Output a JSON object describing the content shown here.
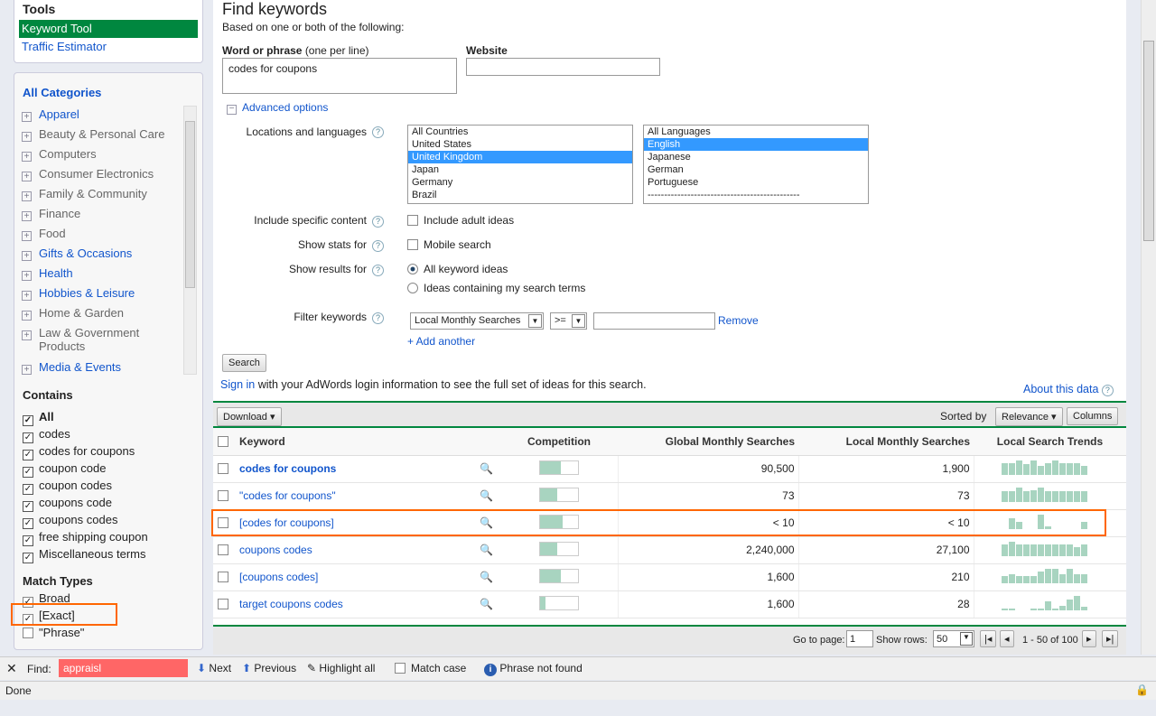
{
  "sidebar": {
    "tools_title": "Tools",
    "tools": [
      "Keyword Tool",
      "Traffic Estimator"
    ],
    "categories_title": "All Categories",
    "categories": [
      "Apparel",
      "Beauty & Personal Care",
      "Computers",
      "Consumer Electronics",
      "Family & Community",
      "Finance",
      "Food",
      "Gifts & Occasions",
      "Health",
      "Hobbies & Leisure",
      "Home & Garden",
      "Law & Government Products",
      "Media & Events"
    ],
    "contains_title": "Contains",
    "contains": [
      "All",
      "codes",
      "codes for coupons",
      "coupon code",
      "coupon codes",
      "coupons code",
      "coupons codes",
      "free shipping coupon",
      "Miscellaneous terms"
    ],
    "match_title": "Match Types",
    "match": [
      {
        "label": "Broad",
        "checked": true
      },
      {
        "label": "[Exact]",
        "checked": true
      },
      {
        "label": "\"Phrase\"",
        "checked": false
      }
    ]
  },
  "form": {
    "title": "Find keywords",
    "subtitle": "Based on one or both of the following:",
    "word_label": "Word or phrase",
    "word_hint": "(one per line)",
    "word_value": "codes for coupons",
    "website_label": "Website",
    "advanced": "Advanced options",
    "loc_label": "Locations and languages",
    "locations": [
      "All Countries",
      "United States",
      "United Kingdom",
      "Japan",
      "Germany",
      "Brazil"
    ],
    "selected_location": "United Kingdom",
    "languages": [
      "All Languages",
      "English",
      "Japanese",
      "German",
      "Portuguese",
      "----------------------------------------------"
    ],
    "selected_language": "English",
    "include_label": "Include specific content",
    "include_opt": "Include adult ideas",
    "stats_label": "Show stats for",
    "stats_opt": "Mobile search",
    "results_label": "Show results for",
    "results_opts": [
      "All keyword ideas",
      "Ideas containing my search terms"
    ],
    "filter_label": "Filter keywords",
    "filter_field": "Local Monthly Searches",
    "filter_op": ">=",
    "remove": "Remove",
    "add_another": "+ Add another",
    "search_btn": "Search",
    "signin": "Sign in",
    "signin_rest": " with your AdWords login information to see the full set of ideas for this search.",
    "about": "About this data"
  },
  "results": {
    "download": "Download",
    "sorted_by": "Sorted by",
    "sort_value": "Relevance",
    "columns": "Columns",
    "headers": [
      "Keyword",
      "Competition",
      "Global Monthly Searches",
      "Local Monthly Searches",
      "Local Search Trends"
    ],
    "rows": [
      {
        "keyword": "codes for coupons",
        "bold": true,
        "competition": 0.55,
        "global": "90,500",
        "local": "1,900",
        "trend": [
          0.8,
          0.8,
          1,
          0.7,
          1,
          0.6,
          0.8,
          1,
          0.8,
          0.8,
          0.8,
          0.6
        ]
      },
      {
        "keyword": "\"codes for coupons\"",
        "competition": 0.45,
        "global": "73",
        "local": "73",
        "trend": [
          0.7,
          0.7,
          1,
          0.7,
          0.8,
          1,
          0.7,
          0.7,
          0.7,
          0.7,
          0.7,
          0.7
        ]
      },
      {
        "keyword": "[codes for coupons]",
        "competition": 0.6,
        "global": "< 10",
        "local": "< 10",
        "trend": [
          0,
          0.7,
          0.5,
          0,
          0,
          1,
          0.15,
          0,
          0,
          0,
          0,
          0.5
        ]
      },
      {
        "keyword": "coupons codes",
        "competition": 0.45,
        "global": "2,240,000",
        "local": "27,100",
        "trend": [
          0.8,
          1,
          0.8,
          0.8,
          0.8,
          0.8,
          0.8,
          0.8,
          0.8,
          0.8,
          0.6,
          0.8
        ]
      },
      {
        "keyword": "[coupons codes]",
        "competition": 0.55,
        "global": "1,600",
        "local": "210",
        "trend": [
          0.5,
          0.6,
          0.5,
          0.5,
          0.5,
          0.8,
          1,
          1,
          0.6,
          1,
          0.6,
          0.6
        ]
      },
      {
        "keyword": "target coupons codes",
        "competition": 0.15,
        "global": "1,600",
        "local": "28",
        "trend": [
          0.1,
          0.1,
          0,
          0,
          0.1,
          0.1,
          0.6,
          0.1,
          0.3,
          0.7,
          1,
          0.2
        ]
      }
    ],
    "goto_label": "Go to page:",
    "page": "1",
    "rows_label": "Show rows:",
    "rows_value": "50",
    "range": "1 - 50 of 100"
  },
  "findbar": {
    "label": "Find:",
    "value": "appraisl",
    "next": "Next",
    "previous": "Previous",
    "highlight": "Highlight all",
    "match_case": "Match case",
    "status": "Phrase not found"
  },
  "statusbar": "Done",
  "colors": {
    "accent": "#00873f",
    "link": "#1155cc",
    "highlight": "#ff6600",
    "bar": "#a8d4c0"
  }
}
